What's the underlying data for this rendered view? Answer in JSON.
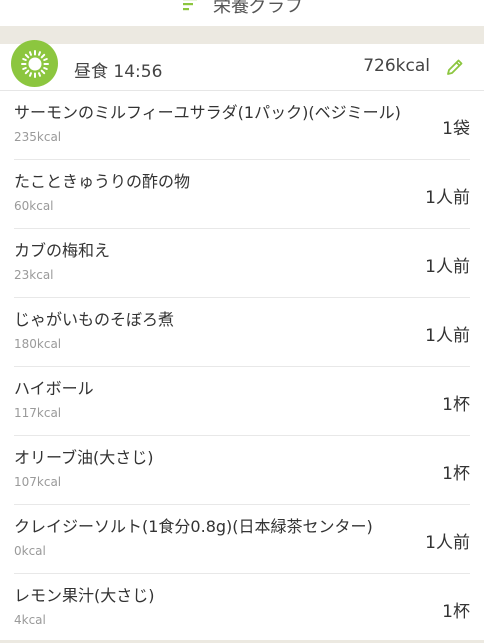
{
  "top_bar": {
    "nutrition_graph_label": "栄養グラフ",
    "icon": "graph-icon"
  },
  "meal": {
    "title": "昼食 14:56",
    "total_kcal": "726kcal",
    "icon": "sun-icon",
    "edit_icon": "pencil-icon",
    "accent_color": "#8cc63f"
  },
  "items": [
    {
      "name": "サーモンのミルフィーユサラダ(1パック)(ベジミール)",
      "kcal": "235kcal",
      "qty": "1袋"
    },
    {
      "name": "たこときゅうりの酢の物",
      "kcal": "60kcal",
      "qty": "1人前"
    },
    {
      "name": "カブの梅和え",
      "kcal": "23kcal",
      "qty": "1人前"
    },
    {
      "name": "じゃがいものそぼろ煮",
      "kcal": "180kcal",
      "qty": "1人前"
    },
    {
      "name": "ハイボール",
      "kcal": "117kcal",
      "qty": "1杯"
    },
    {
      "name": "オリーブ油(大さじ)",
      "kcal": "107kcal",
      "qty": "1杯"
    },
    {
      "name": "クレイジーソルト(1食分0.8g)(日本緑茶センター)",
      "kcal": "0kcal",
      "qty": "1人前"
    },
    {
      "name": "レモン果汁(大さじ)",
      "kcal": "4kcal",
      "qty": "1杯"
    }
  ]
}
